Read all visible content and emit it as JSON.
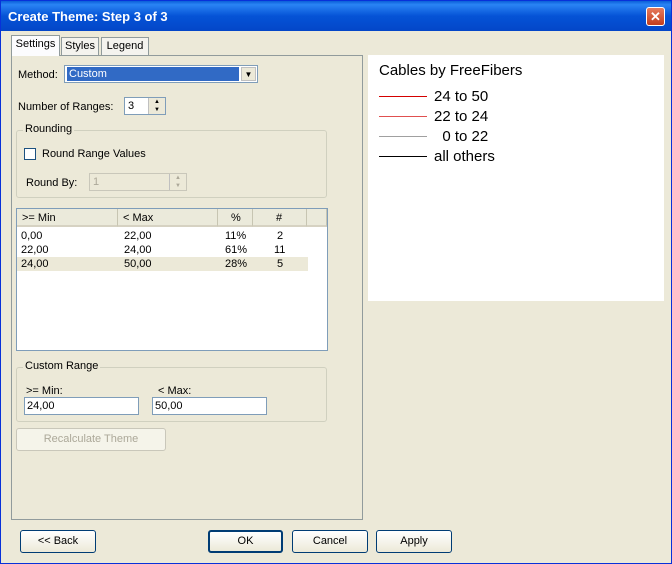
{
  "window": {
    "title": "Create Theme: Step 3 of 3",
    "close_glyph": "✕"
  },
  "tabs": [
    {
      "label": "Settings",
      "active": true
    },
    {
      "label": "Styles",
      "active": false
    },
    {
      "label": "Legend",
      "active": false
    }
  ],
  "settings": {
    "method_label": "Method:",
    "method_value": "Custom",
    "ranges_label": "Number of Ranges:",
    "ranges_value": "3",
    "rounding": {
      "title": "Rounding",
      "checkbox_label": "Round Range Values",
      "checked": false,
      "round_by_label": "Round By:",
      "round_by_value": "1"
    },
    "table": {
      "headers": [
        ">= Min",
        "< Max",
        "%",
        "#"
      ],
      "rows": [
        {
          "min": "0,00",
          "max": "22,00",
          "pct": "11%",
          "count": "2",
          "selected": false
        },
        {
          "min": "22,00",
          "max": "24,00",
          "pct": "61%",
          "count": "11",
          "selected": false
        },
        {
          "min": "24,00",
          "max": "50,00",
          "pct": "28%",
          "count": "5",
          "selected": true
        }
      ]
    },
    "custom_range": {
      "title": "Custom Range",
      "min_label": ">= Min:",
      "min_value": "24,00",
      "max_label": "< Max:",
      "max_value": "50,00"
    },
    "recalc_label": "Recalculate Theme"
  },
  "preview": {
    "title": "Cables by FreeFibers",
    "legend": [
      {
        "label": "24 to 50",
        "color": "#d40000"
      },
      {
        "label": "22 to 24",
        "color": "#e05050"
      },
      {
        "label": "  0 to 22",
        "color": "#a0a0a0"
      },
      {
        "label": "all others",
        "color": "#000000"
      }
    ]
  },
  "buttons": {
    "back": "<< Back",
    "ok": "OK",
    "cancel": "Cancel",
    "apply": "Apply"
  }
}
